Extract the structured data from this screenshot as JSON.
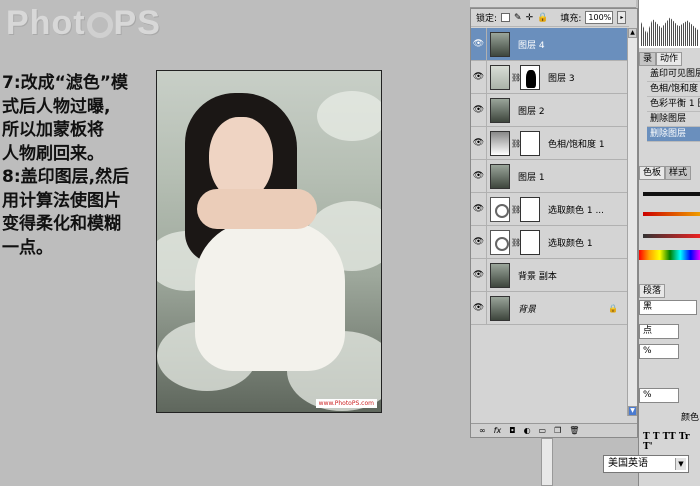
{
  "logo_text": [
    "Phot",
    "PS"
  ],
  "caption": {
    "step7": "7:改成“滤色”模\n式后人物过曝,\n所以加蒙板将\n人物刷回来。",
    "step8": "8:盖印图层,然后\n用计算法使图片\n变得柔化和模糊\n一点。"
  },
  "photo": {
    "watermark": "www.PhotoPS.com"
  },
  "layers_panel": {
    "lock_label": "锁定:",
    "fill_label": "填充:",
    "fill_value": "100%",
    "layers": [
      {
        "name": "图层 4",
        "selected": true,
        "thumb": "photo",
        "mask": ""
      },
      {
        "name": "图层 3",
        "selected": false,
        "thumb": "photo-light",
        "mask": "dark"
      },
      {
        "name": "图层 2",
        "selected": false,
        "thumb": "photo",
        "mask": ""
      },
      {
        "name": "色相/饱和度 1",
        "selected": false,
        "thumb": "grad",
        "mask": "white"
      },
      {
        "name": "图层 1",
        "selected": false,
        "thumb": "photo",
        "mask": ""
      },
      {
        "name": "选取颜色 1 ...",
        "selected": false,
        "thumb": "adj",
        "mask": "white"
      },
      {
        "name": "选取颜色 1",
        "selected": false,
        "thumb": "adj",
        "mask": "white"
      },
      {
        "name": "背景 副本",
        "selected": false,
        "thumb": "photo",
        "mask": ""
      },
      {
        "name": "背景",
        "selected": false,
        "thumb": "photo",
        "mask": "",
        "italic": true,
        "locked": true
      }
    ],
    "bottom_icons": [
      "link-icon",
      "fx-icon",
      "mask-icon",
      "adjust-icon",
      "folder-icon",
      "new-layer-icon",
      "trash-icon"
    ]
  },
  "right_panel": {
    "tabs": [
      "录",
      "动作"
    ],
    "history": [
      "盖印可见图层",
      "色相/饱和度",
      "色彩平衡 1 图",
      "删除图层",
      "删除图层"
    ],
    "color_tabs": [
      "色板",
      "样式"
    ],
    "char_tab": "段落",
    "font_size": "点",
    "pct1": "%",
    "pct2": "%",
    "color_label": "颜色",
    "text_toggles": "T T  TT Tr T'",
    "aa_label": "a"
  },
  "language": "美国英语",
  "colors": {
    "selection": "#6a8fbd",
    "panel": "#d4d4d4",
    "background": "#bdbdbd"
  }
}
